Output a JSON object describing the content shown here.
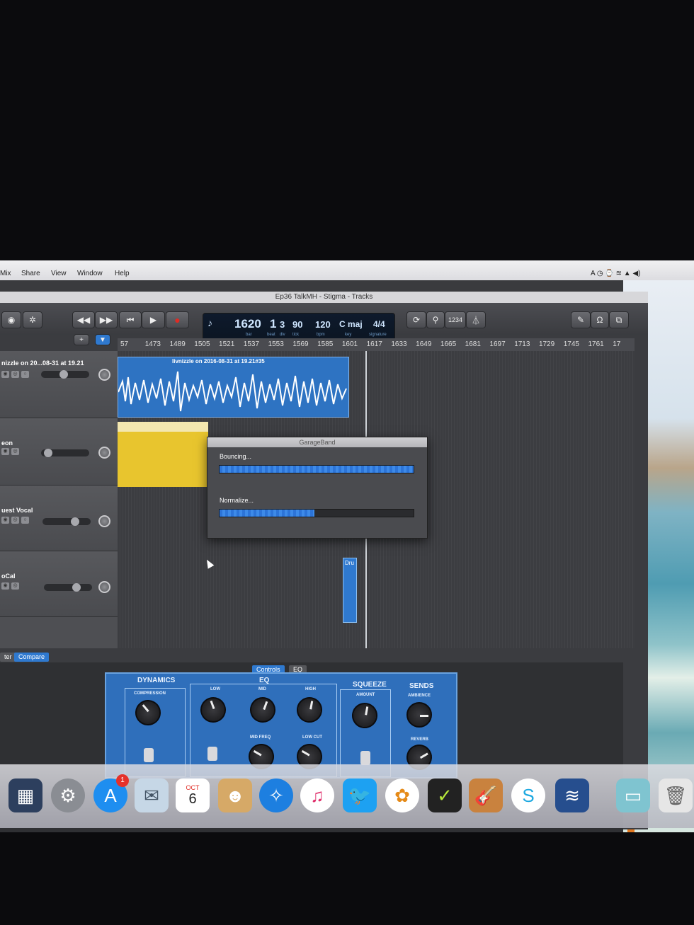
{
  "menubar": {
    "items": [
      "Mix",
      "Share",
      "View",
      "Window",
      "Help"
    ]
  },
  "window": {
    "title": "Ep36 TalkMH - Stigma - Tracks"
  },
  "lcd": {
    "bar": "1620",
    "bar_label": "bar",
    "beat": "1",
    "beat_label": "beat",
    "div": "3",
    "div_label": "div",
    "tick": "90",
    "tick_label": "tick",
    "tempo": "120",
    "tempo_label": "bpm",
    "key": "C maj",
    "key_label": "key",
    "signature": "4/4",
    "signature_label": "signature"
  },
  "toolbar": {
    "count_in": "1234"
  },
  "ruler": {
    "marks": [
      "57",
      "1473",
      "1489",
      "1505",
      "1521",
      "1537",
      "1553",
      "1569",
      "1585",
      "1601",
      "1617",
      "1633",
      "1649",
      "1665",
      "1681",
      "1697",
      "1713",
      "1729",
      "1745",
      "1761",
      "17"
    ]
  },
  "tracks": [
    {
      "name": "nizzle on 20...08-31 at 19.21"
    },
    {
      "name": "eon"
    },
    {
      "name": "uest Vocal"
    },
    {
      "name": "oCal"
    }
  ],
  "regions": {
    "region1_title": "livnizzle on 2016-08-31 at 19.21#35",
    "region3_title": "Dru"
  },
  "dialog": {
    "title": "GarageBand",
    "bouncing_label": "Bouncing...",
    "bouncing_progress": 1.0,
    "normalize_label": "Normalize...",
    "normalize_progress": 0.49
  },
  "lower": {
    "left_tab": "ter",
    "compare_label": "Compare",
    "tabs": [
      "Controls",
      "EQ"
    ]
  },
  "plugin": {
    "dynamics": "DYNAMICS",
    "compression": "COMPRESSION",
    "eq": "EQ",
    "low": "LOW",
    "mid": "MID",
    "high": "HIGH",
    "mid_freq": "MID FREQ",
    "low_cut": "LOW CUT",
    "squeeze": "SQUEEZE",
    "amount": "AMOUNT",
    "sends": "SENDS",
    "ambience": "AMBIENCE",
    "reverb": "REVERB"
  },
  "dock": {
    "calendar_month": "OCT",
    "calendar_day": "6",
    "appstore_badge": "1",
    "icons": [
      "mission-control",
      "system-preferences",
      "app-store",
      "mail",
      "calendar",
      "contacts",
      "safari",
      "itunes",
      "twitter",
      "photos",
      "nike-plus",
      "garageband",
      "skype",
      "audio-editor",
      "downloads-folder",
      "trash"
    ]
  },
  "colors": {
    "accent_blue": "#2f79cf",
    "region_yellow": "#e8c52e",
    "record_red": "#e02b24",
    "dock_bg": "#cfcfd6"
  }
}
